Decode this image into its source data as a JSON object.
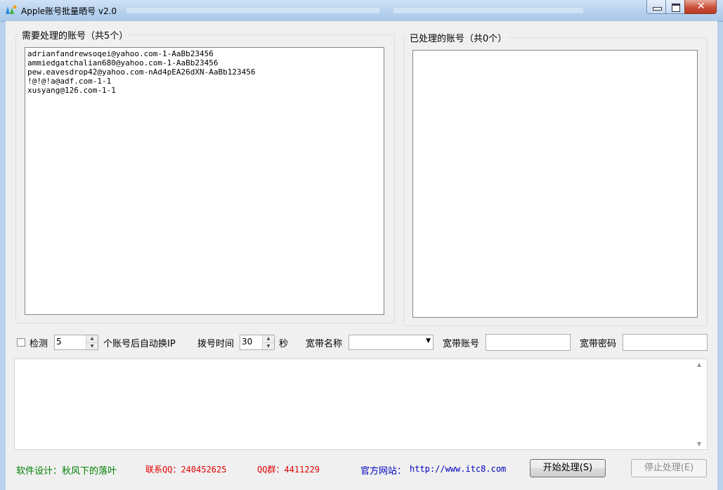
{
  "window": {
    "title": "Apple账号批量晒号 v2.0",
    "close_glyph": "✕"
  },
  "pending": {
    "title": "需要处理的账号（共5个）",
    "items": [
      "adrianfandrewsoqei@yahoo.com-1-AaBb23456",
      "ammiedgatchalian680@yahoo.com-1-AaBb23456",
      "pew.eavesdrop42@yahoo.com-nAd4pEA26dXN-AaBb123456",
      "!@!@!a@adf.com-1-1",
      "xusyang@126.com-1-1"
    ]
  },
  "processed": {
    "title": "已处理的账号（共0个）",
    "items": []
  },
  "controls": {
    "check_label": "检测",
    "count_value": "5",
    "count_suffix": "个账号后自动换IP",
    "dial_label": "拨号时间",
    "dial_value": "30",
    "dial_unit": "秒",
    "broadband_name_label": "宽带名称",
    "broadband_name_value": "",
    "broadband_account_label": "宽带账号",
    "broadband_account_value": "",
    "broadband_password_label": "宽带密码",
    "broadband_password_value": ""
  },
  "footer": {
    "design": "软件设计：秋风下的落叶",
    "contact": "联系QQ：240452625",
    "group": "QQ群：4411229",
    "site_label": "官方网站：",
    "site_url": "http://www.itc8.com",
    "start_label": "开始处理(S)",
    "stop_label": "停止处理(E)"
  },
  "colors": {
    "design": "#008000",
    "contact": "#e00000",
    "site": "#0000c0"
  }
}
